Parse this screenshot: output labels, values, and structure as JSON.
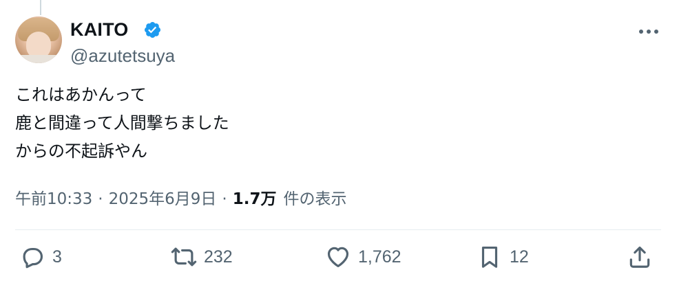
{
  "author": {
    "display_name": "KAITO",
    "handle": "@azutetsuya",
    "verified": true,
    "verified_color": "#1d9bf0"
  },
  "tweet": {
    "lines": [
      "これはあかんって",
      "鹿と間違って人間撃ちました",
      "からの不起訴やん"
    ]
  },
  "meta": {
    "time": "午前10:33",
    "separator1": "·",
    "date": "2025年6月9日",
    "separator2": "·",
    "views_count": "1.7万",
    "views_label": "件の表示"
  },
  "actions": {
    "reply": {
      "icon": "reply-icon",
      "count": "3"
    },
    "retweet": {
      "icon": "retweet-icon",
      "count": "232"
    },
    "like": {
      "icon": "heart-icon",
      "count": "1,762"
    },
    "bookmark": {
      "icon": "bookmark-icon",
      "count": "12"
    },
    "share": {
      "icon": "share-icon"
    }
  },
  "colors": {
    "text_primary": "#0f1419",
    "text_secondary": "#536471",
    "divider": "#e6ecf0"
  }
}
